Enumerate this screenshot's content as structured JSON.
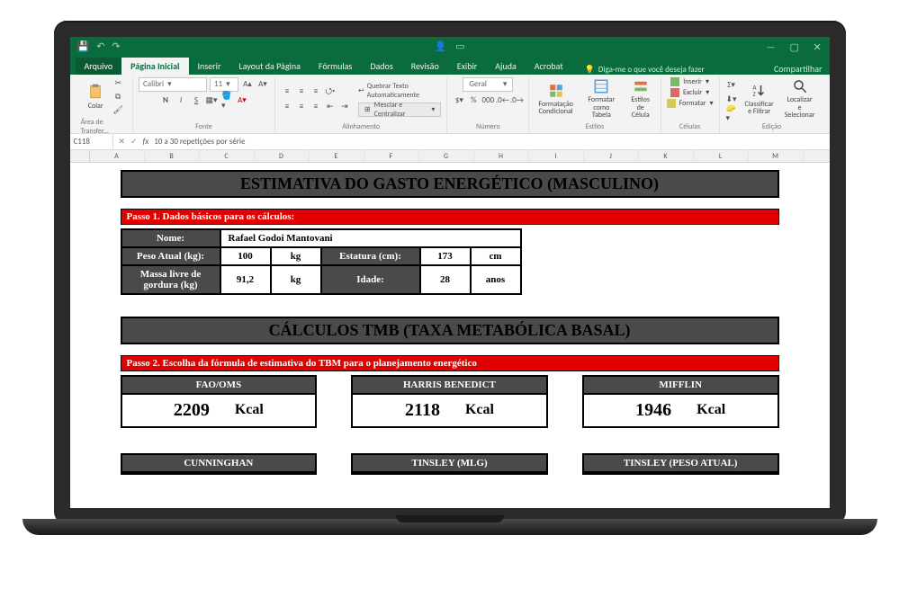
{
  "window": {
    "app": "Excel"
  },
  "ribbon": {
    "tabs": {
      "file": "Arquivo",
      "home": "Página Inicial",
      "insert": "Inserir",
      "page_layout": "Layout da Página",
      "formulas": "Fórmulas",
      "data": "Dados",
      "review": "Revisão",
      "view": "Exibir",
      "help": "Ajuda",
      "acrobat": "Acrobat"
    },
    "tell_me": "Diga-me o que você deseja fazer",
    "share": "Compartilhar",
    "font": {
      "name": "Calibri",
      "size": "11"
    },
    "wrap_text": "Quebrar Texto Automaticamente",
    "merge": "Mesclar e Centralizar",
    "number_format": "Geral",
    "paste": "Colar",
    "groups": {
      "clipboard": "Área de Transfer...",
      "font": "Fonte",
      "alignment": "Alinhamento",
      "number": "Número",
      "styles": "Estilos",
      "cells": "Células",
      "editing": "Edição"
    },
    "styles": {
      "cond": "Formatação\nCondicional",
      "table": "Formatar como\nTabela",
      "cell": "Estilos de\nCélula"
    },
    "cells": {
      "insert": "Inserir",
      "delete": "Excluir",
      "format": "Formatar"
    },
    "editing": {
      "sort": "Classificar\ne Filtrar",
      "find": "Localizar e\nSelecionar"
    }
  },
  "formula_bar": {
    "cell_ref": "C118",
    "formula": "10 a 30 repetições por série"
  },
  "columns": [
    "A",
    "B",
    "C",
    "D",
    "E",
    "F",
    "G",
    "H",
    "I",
    "J",
    "K",
    "L",
    "M"
  ],
  "sheet": {
    "title1": "ESTIMATIVA DO GASTO ENERGÉTICO (MASCULINO)",
    "step1": {
      "prefix": "Passo 1.",
      "text": "Dados básicos para os cálculos:"
    },
    "fields": {
      "nome_label": "Nome:",
      "nome_value": "Rafael Godoi Mantovani",
      "peso_label": "Peso Atual (kg):",
      "peso_value": "100",
      "peso_unit": "kg",
      "estatura_label": "Estatura (cm):",
      "estatura_value": "173",
      "estatura_unit": "cm",
      "massa_label": "Massa livre de\ngordura (kg)",
      "massa_value": "91,2",
      "massa_unit": "kg",
      "idade_label": "Idade:",
      "idade_value": "28",
      "idade_unit": "anos"
    },
    "title2": "CÁLCULOS TMB (TAXA METABÓLICA BASAL)",
    "step2": {
      "prefix": "Passo 2.",
      "text": "Escolha da fórmula de estimativa do TBM para o planejamento energético"
    },
    "tmb_unit": "Kcal",
    "tmb": [
      {
        "name": "FAO/OMS",
        "value": "2209"
      },
      {
        "name": "HARRIS BENEDICT",
        "value": "2118"
      },
      {
        "name": "MIFFLIN",
        "value": "1946"
      }
    ],
    "tmb2": [
      {
        "name": "CUNNINGHAN"
      },
      {
        "name": "TINSLEY (MLG)"
      },
      {
        "name": "TINSLEY (PESO ATUAL)"
      }
    ]
  }
}
